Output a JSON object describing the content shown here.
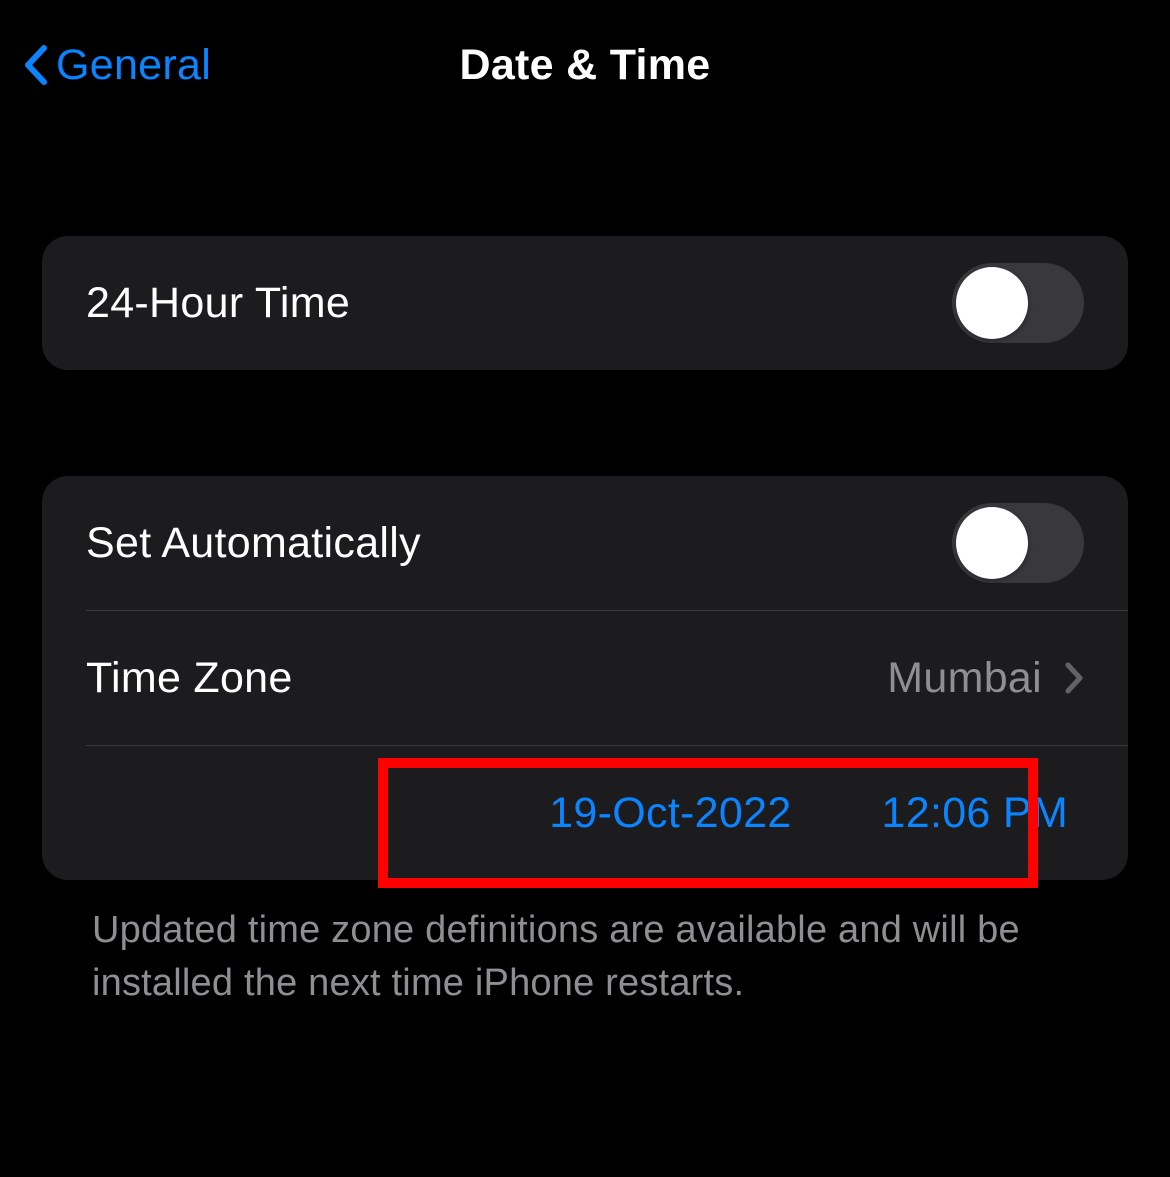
{
  "nav": {
    "back_label": "General",
    "title": "Date & Time"
  },
  "group1": {
    "twenty_four_hour_label": "24-Hour Time"
  },
  "group2": {
    "set_auto_label": "Set Automatically",
    "timezone_label": "Time Zone",
    "timezone_value": "Mumbai",
    "date_value": "19-Oct-2022",
    "time_value": "12:06 PM"
  },
  "footer": "Updated time zone definitions are available and will be installed the next time iPhone restarts."
}
